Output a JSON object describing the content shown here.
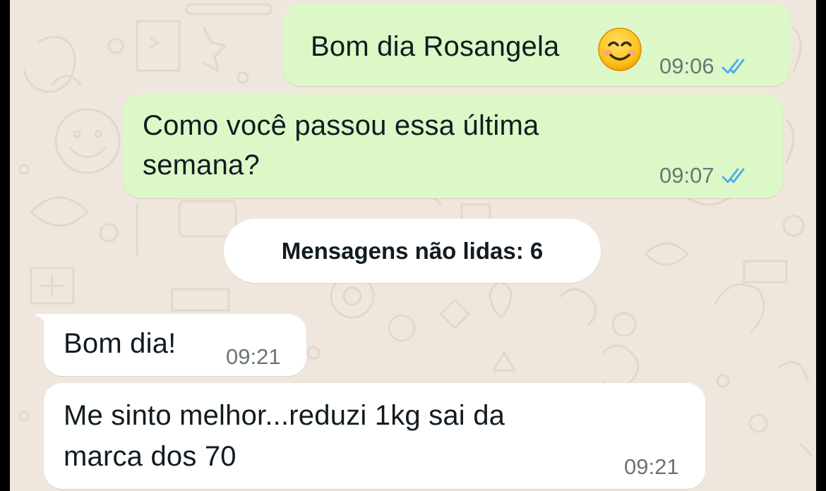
{
  "chat": {
    "messages": [
      {
        "direction": "outgoing",
        "text": "Bom dia Rosangela",
        "emoji": "smiling-face-icon",
        "time": "09:06",
        "status": "read"
      },
      {
        "direction": "outgoing",
        "text_lines": [
          "Como você passou essa última",
          "semana?"
        ],
        "time": "09:07",
        "status": "read"
      },
      {
        "direction": "incoming",
        "text": "Bom dia!",
        "time": "09:21"
      },
      {
        "direction": "incoming",
        "text_lines": [
          "Me sinto melhor...reduzi 1kg sai da",
          "marca dos 70"
        ],
        "time": "09:21"
      }
    ],
    "unread_banner": "Mensagens não lidas: 6"
  },
  "colors": {
    "outgoing_bubble": "#dcf8c6",
    "incoming_bubble": "#ffffff",
    "wallpaper": "#efe7dd",
    "read_ticks": "#4fa9f0"
  }
}
